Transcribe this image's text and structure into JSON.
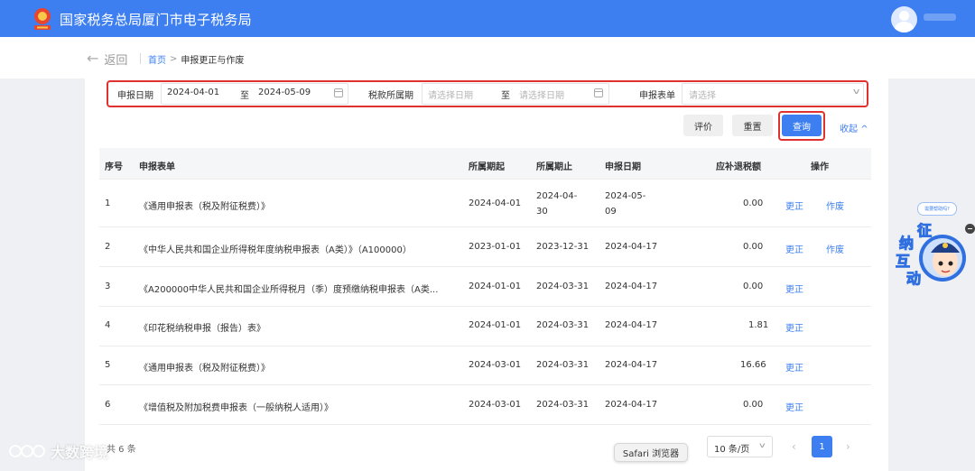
{
  "header": {
    "site_title": "国家税务总局厦门市电子税务局",
    "emblem_icon": "tax-emblem-icon",
    "avatar_icon": "user-avatar-icon",
    "brand_color": "#3d7ff0"
  },
  "nav": {
    "back_label": "返回",
    "breadcrumb": {
      "home": "首页",
      "separator": ">",
      "current": "申报更正与作废"
    }
  },
  "filters": {
    "declare_date_label": "申报日期",
    "declare_date_start": "2024-04-01",
    "declare_date_to": "至",
    "declare_date_end": "2024-05-09",
    "tax_period_label": "税款所属期",
    "tax_period_start_placeholder": "请选择日期",
    "tax_period_to": "至",
    "tax_period_end_placeholder": "请选择日期",
    "form_label": "申报表单",
    "form_placeholder": "请选择"
  },
  "actions": {
    "evaluate": "评价",
    "reset": "重置",
    "query": "查询",
    "collapse": "收起"
  },
  "table": {
    "columns": [
      "序号",
      "申报表单",
      "所属期起",
      "所属期止",
      "申报日期",
      "应补退税额",
      "操作"
    ],
    "rows": [
      {
        "no": "1",
        "form": "《通用申报表（税及附征税费）》",
        "start": "2024-04-01",
        "end_a": "2024-04-",
        "end_b": "30",
        "date_a": "2024-05-",
        "date_b": "09",
        "amount": "0.00",
        "correct": "更正",
        "void": "作废"
      },
      {
        "no": "2",
        "form": "《中华人民共和国企业所得税年度纳税申报表（A类）》（A100000）",
        "start": "2023-01-01",
        "end": "2023-12-31",
        "date": "2024-04-17",
        "amount": "0.00",
        "correct": "更正",
        "void": "作废"
      },
      {
        "no": "3",
        "form": "《A200000中华人民共和国企业所得税月（季）度预缴纳税申报表（A类...",
        "start": "2024-01-01",
        "end": "2024-03-31",
        "date": "2024-04-17",
        "amount": "0.00",
        "correct": "更正"
      },
      {
        "no": "4",
        "form": "《印花税纳税申报（报告）表》",
        "start": "2024-01-01",
        "end": "2024-03-31",
        "date": "2024-04-17",
        "amount": "1.81",
        "correct": "更正"
      },
      {
        "no": "5",
        "form": "《通用申报表（税及附征税费）》",
        "start": "2024-03-01",
        "end": "2024-03-31",
        "date": "2024-04-17",
        "amount": "16.66",
        "correct": "更正"
      },
      {
        "no": "6",
        "form": "《增值税及附加税费申报表（一般纳税人适用）》",
        "start": "2024-03-01",
        "end": "2024-03-31",
        "date": "2024-04-17",
        "amount": "0.00",
        "correct": "更正"
      }
    ]
  },
  "pagination": {
    "total": "共 6 条",
    "page_size": "10 条/页",
    "current_page": "1"
  },
  "overlay": {
    "safari_tip": "Safari 浏览器",
    "watermark": "大数跨境",
    "helper_bubble": "需要帮助吗?",
    "helper_chars": [
      "征",
      "纳",
      "互",
      "动"
    ]
  }
}
